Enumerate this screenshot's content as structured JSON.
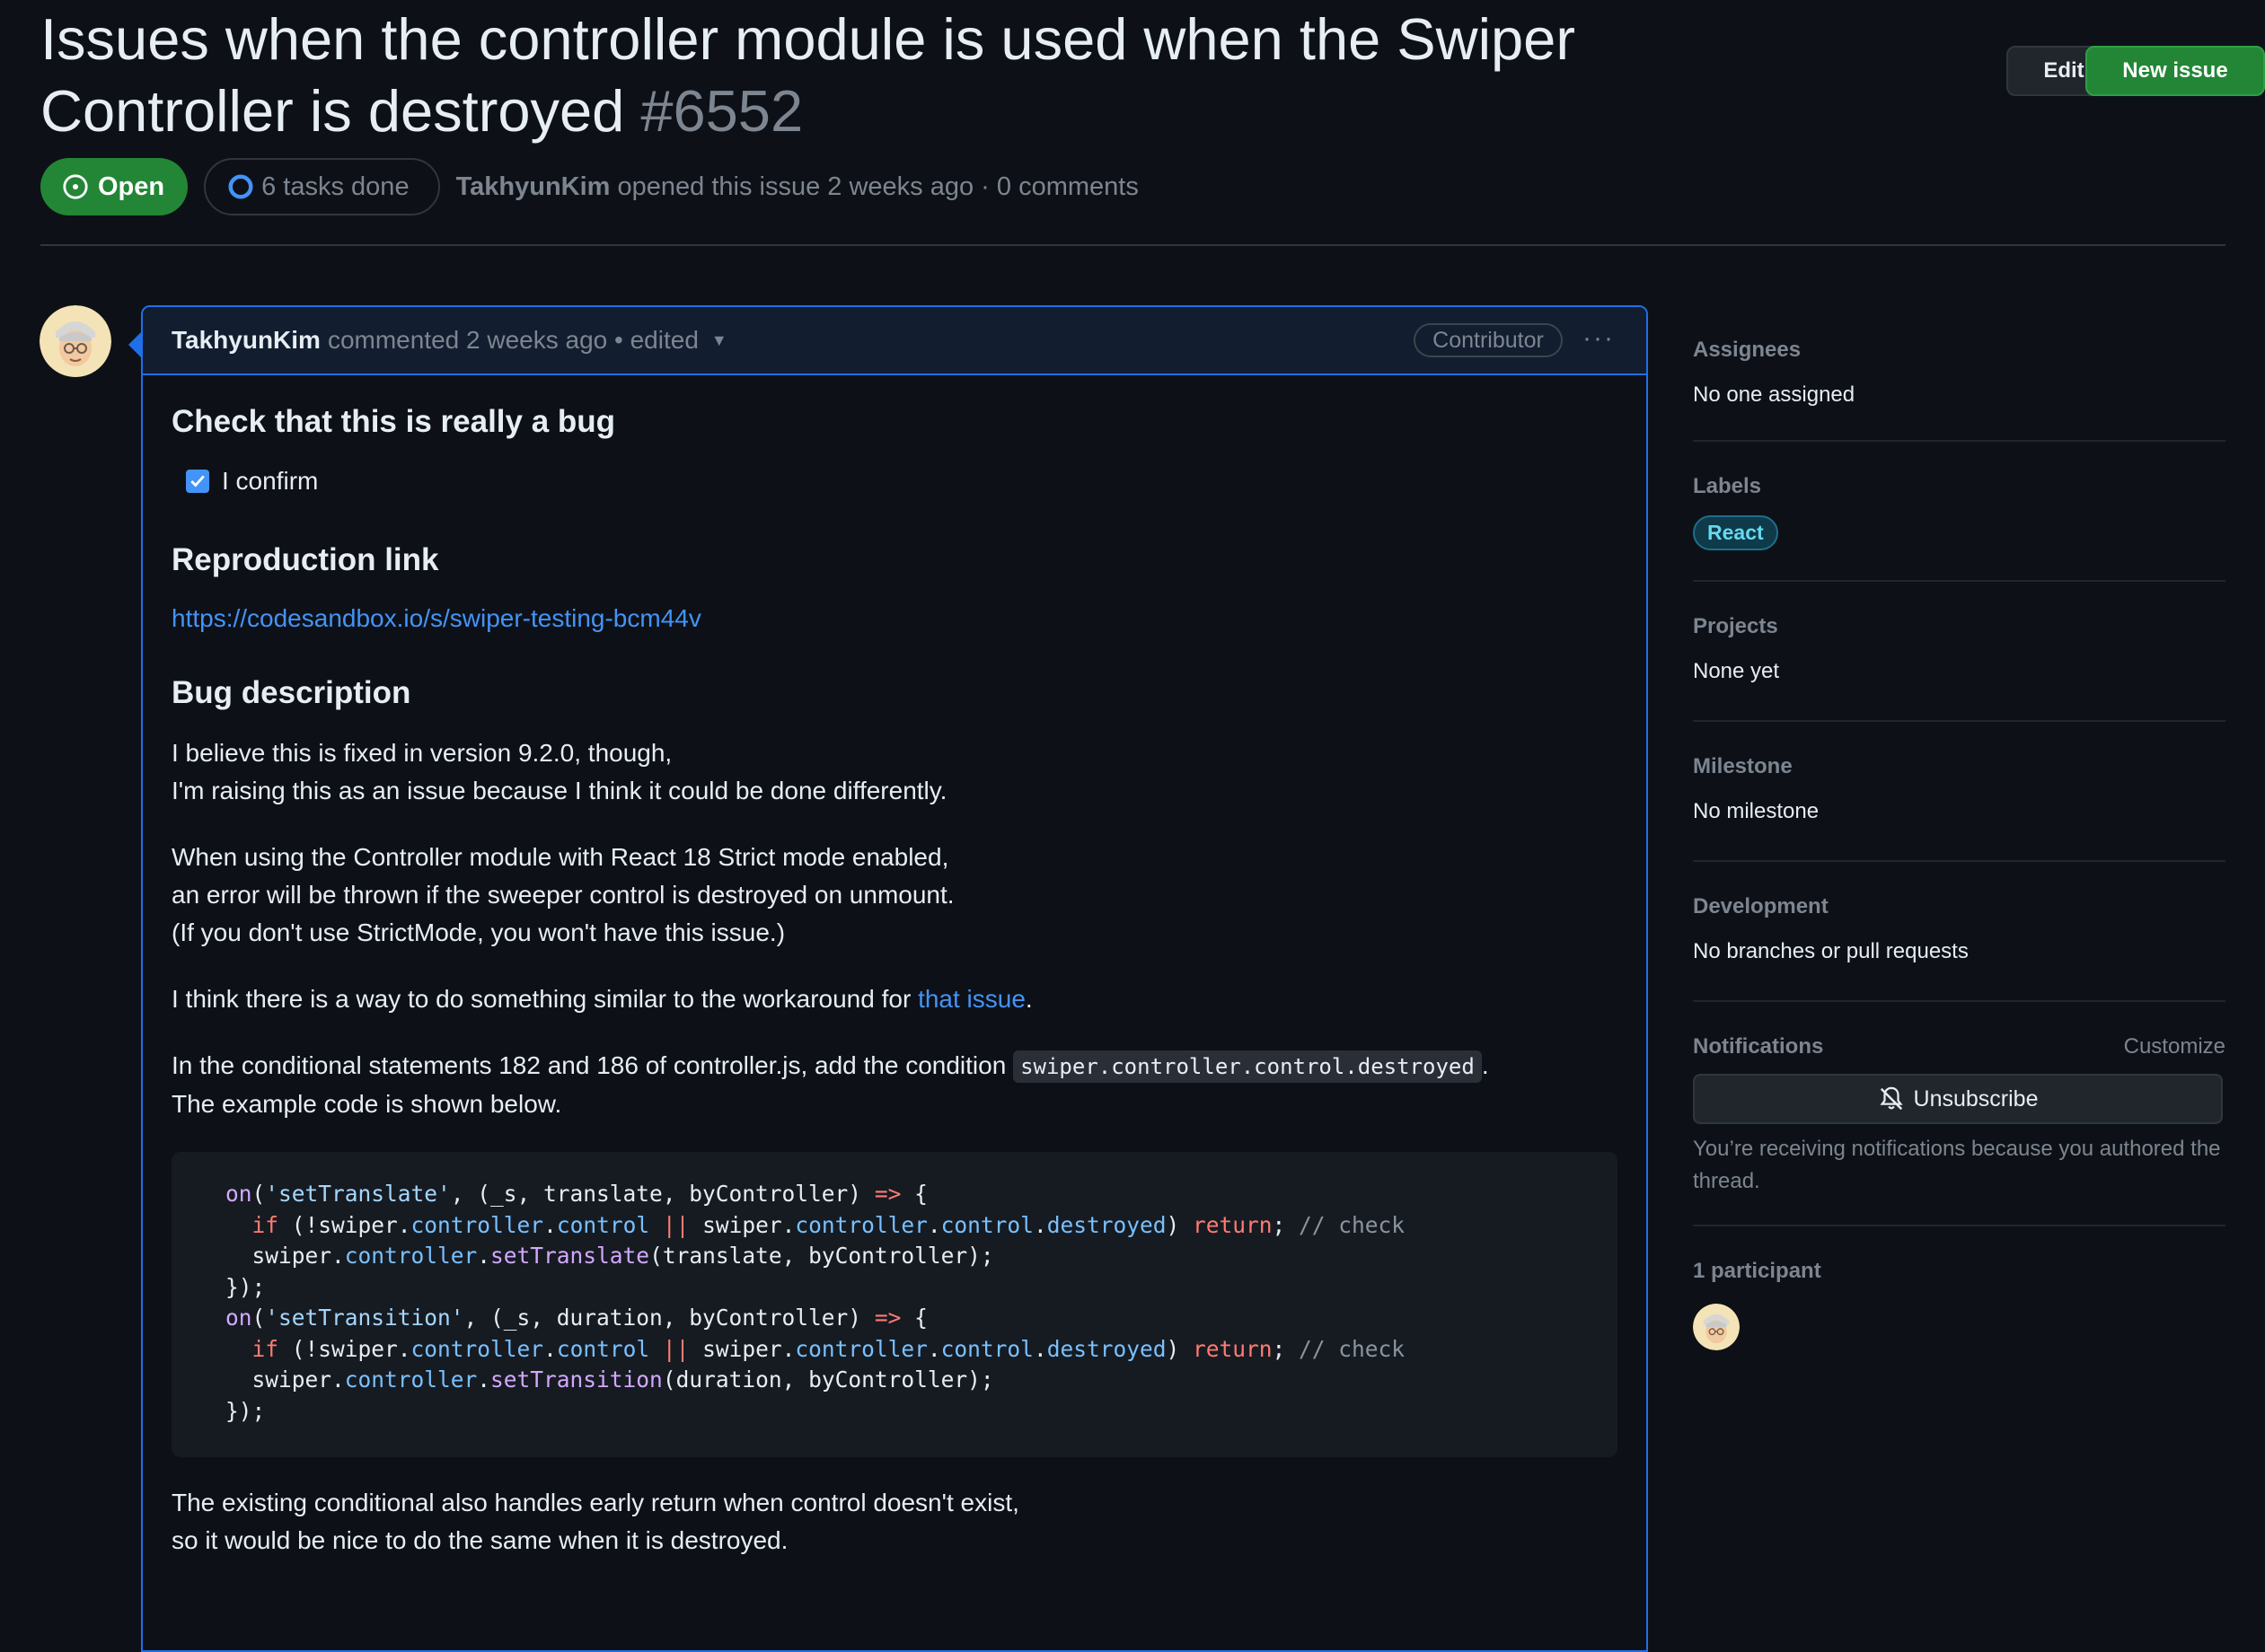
{
  "issue": {
    "title": "Issues when the controller module is used when the Swiper Controller is destroyed",
    "number": "#6552",
    "edit_label": "Edit",
    "new_issue_label": "New issue",
    "state_label": "Open",
    "tasks_label": "6 tasks done",
    "author": "TakhyunKim",
    "opened_text": "opened this issue 2 weeks ago · 0 comments"
  },
  "comment": {
    "author": "TakhyunKim",
    "meta": "commented 2 weeks ago • edited",
    "role_badge": "Contributor",
    "menu_label": "···",
    "h_check": "Check that this is really a bug",
    "confirm_label": "I confirm",
    "h_repro": "Reproduction link",
    "repro_link": "https://codesandbox.io/s/swiper-testing-bcm44v",
    "h_bug": "Bug description",
    "p1_line1": "I believe this is fixed in version 9.2.0, though,",
    "p1_line2": "I'm raising this as an issue because I think it could be done differently.",
    "p2_line1": "When using the Controller module with React 18 Strict mode enabled,",
    "p2_line2": "an error will be thrown if the sweeper control is destroyed on unmount.",
    "p2_line3": "(If you don't use StrictMode, you won't have this issue.)",
    "p3_pre": "I think there is a way to do something similar to the workaround for ",
    "p3_link": "that issue",
    "p3_post": ".",
    "p4_pre": "In the conditional statements 182 and 186 of controller.js, add the condition ",
    "p4_code": "swiper.controller.control.destroyed",
    "p4_post": ".",
    "p4_line2": "The example code is shown below.",
    "p5_line1": "The existing conditional also handles early return when control doesn't exist,",
    "p5_line2": "so it would be nice to do the same when it is destroyed."
  },
  "sidebar": {
    "assignees_head": "Assignees",
    "assignees_val": "No one assigned",
    "labels_head": "Labels",
    "label_react": "React",
    "projects_head": "Projects",
    "projects_val": "None yet",
    "milestone_head": "Milestone",
    "milestone_val": "No milestone",
    "development_head": "Development",
    "development_val": "No branches or pull requests",
    "notifications_head": "Notifications",
    "customize_label": "Customize",
    "unsubscribe_label": "Unsubscribe",
    "notif_note": "You’re receiving notifications because you authored the thread.",
    "participants_head": "1 participant"
  },
  "colors": {
    "accent_blue": "#1f6feb",
    "open_green": "#238636",
    "label_react_text": "#67d8ef"
  }
}
